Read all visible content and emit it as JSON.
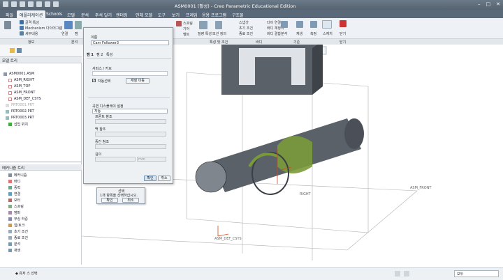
{
  "title_bar": {
    "title": "ASM0001 (활성) - Creo Parametric Educational Edition"
  },
  "tabs": [
    "파일",
    "애플리케이션",
    "Schools",
    "모델",
    "분석",
    "주석 달기",
    "렌더링",
    "인체 모델",
    "도구",
    "보기",
    "프레임",
    "응용 프로그램",
    "구조물"
  ],
  "ribbon": {
    "items": [
      "골격 특성",
      "Mechanism 다이어그램",
      "세부내용",
      "연결",
      "캠",
      "기어",
      "스프링",
      "기어",
      "벨트",
      "모터",
      "력",
      "서보 모터",
      "질량 특성",
      "모션 정의",
      "스냅샷",
      "측정",
      "초기 조건",
      "종료 조건",
      "다이 연결",
      "바디 재정의",
      "바디 결합",
      "분석",
      "재생",
      "측정",
      "스케치",
      "닫기"
    ],
    "groups": [
      "정보",
      "본석",
      "특성 및 조건",
      "바디",
      "기준",
      "닫기"
    ]
  },
  "model_tree": {
    "header": "모델 트리",
    "items": [
      "ASM0001.ASM",
      "ASM_RIGHT",
      "ASM_TOP",
      "ASM_FRONT",
      "ASM_DEF_CSYS",
      "PRT0001.PRT",
      "PRT0002.PRT",
      "PRT0003.PRT",
      "삽입 위치"
    ]
  },
  "mech_tree": {
    "header": "메커니즘 트리",
    "items": [
      "메커니즘",
      "바디",
      "중력",
      "연결",
      "모터",
      "스프링",
      "댐퍼",
      "부싱 하중",
      "힘/토크",
      "초기 조건",
      "종료 조건",
      "분석",
      "재생"
    ]
  },
  "dialog": {
    "name_label": "이름",
    "name_value": "Cam Follower3",
    "tab1": "캠 1",
    "tab2": "캠 2",
    "tab3": "특성",
    "section_surface": "서피스 / 커브",
    "autoselect": "자동선택",
    "flip": "재질 이동",
    "section_display": "곡면 디스플레이 설정",
    "display_mode": "자동",
    "front_ref": "프론트 참조",
    "back_ref": "백 참조",
    "middle_ref": "중간 참조",
    "depth": "깊이",
    "depth_unit": "mm",
    "ok": "확인",
    "cancel": "취소"
  },
  "select_popup": {
    "title": "선택",
    "message": "1개 항목을 선택하십시오.",
    "ok": "확인",
    "cancel": "취소"
  },
  "viewport_labels": {
    "front": "ASM_FRONT",
    "right": "RIGHT",
    "csys": "ASM_DEF_CSYS"
  },
  "status": {
    "left": "◆ 유저 스 선택",
    "filter": "모두"
  },
  "colors": {
    "tabbar": "#59697a",
    "body": "#5b6169",
    "cam": "#7a9a3a"
  }
}
